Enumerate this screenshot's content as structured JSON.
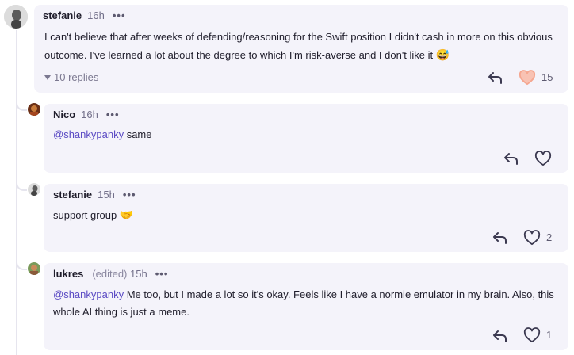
{
  "comments": [
    {
      "author": "stefanie",
      "time": "16h",
      "text": "I can't believe that after weeks of defending/reasoning for the Swift position I didn't cash in more on this obvious outcome. I've learned a lot about the degree to which I'm risk-averse and I don't like it",
      "emoji": "😅",
      "replies_label": "10 replies",
      "likes": "15",
      "liked": true
    },
    {
      "author": "Nico",
      "time": "16h",
      "mention": "@shankypanky",
      "text": "same",
      "likes": ""
    },
    {
      "author": "stefanie",
      "time": "15h",
      "text": "support group",
      "emoji": "🤝",
      "likes": "2"
    },
    {
      "author": "lukres",
      "edited": "(edited)",
      "time": "15h",
      "mention": "@shankypanky",
      "text": "Me too, but I made a lot so it's okay. Feels like I have a normie emulator in my brain. Also, this whole AI thing is just a meme.",
      "likes": "1"
    }
  ],
  "colors": {
    "card_bg": "#f4f3fa",
    "mention": "#5b4bc4",
    "liked_heart": "#f5a68f",
    "icon": "#3b3950"
  },
  "icons": [
    "reply-icon",
    "heart-icon",
    "more-options-icon",
    "caret-down-icon"
  ]
}
